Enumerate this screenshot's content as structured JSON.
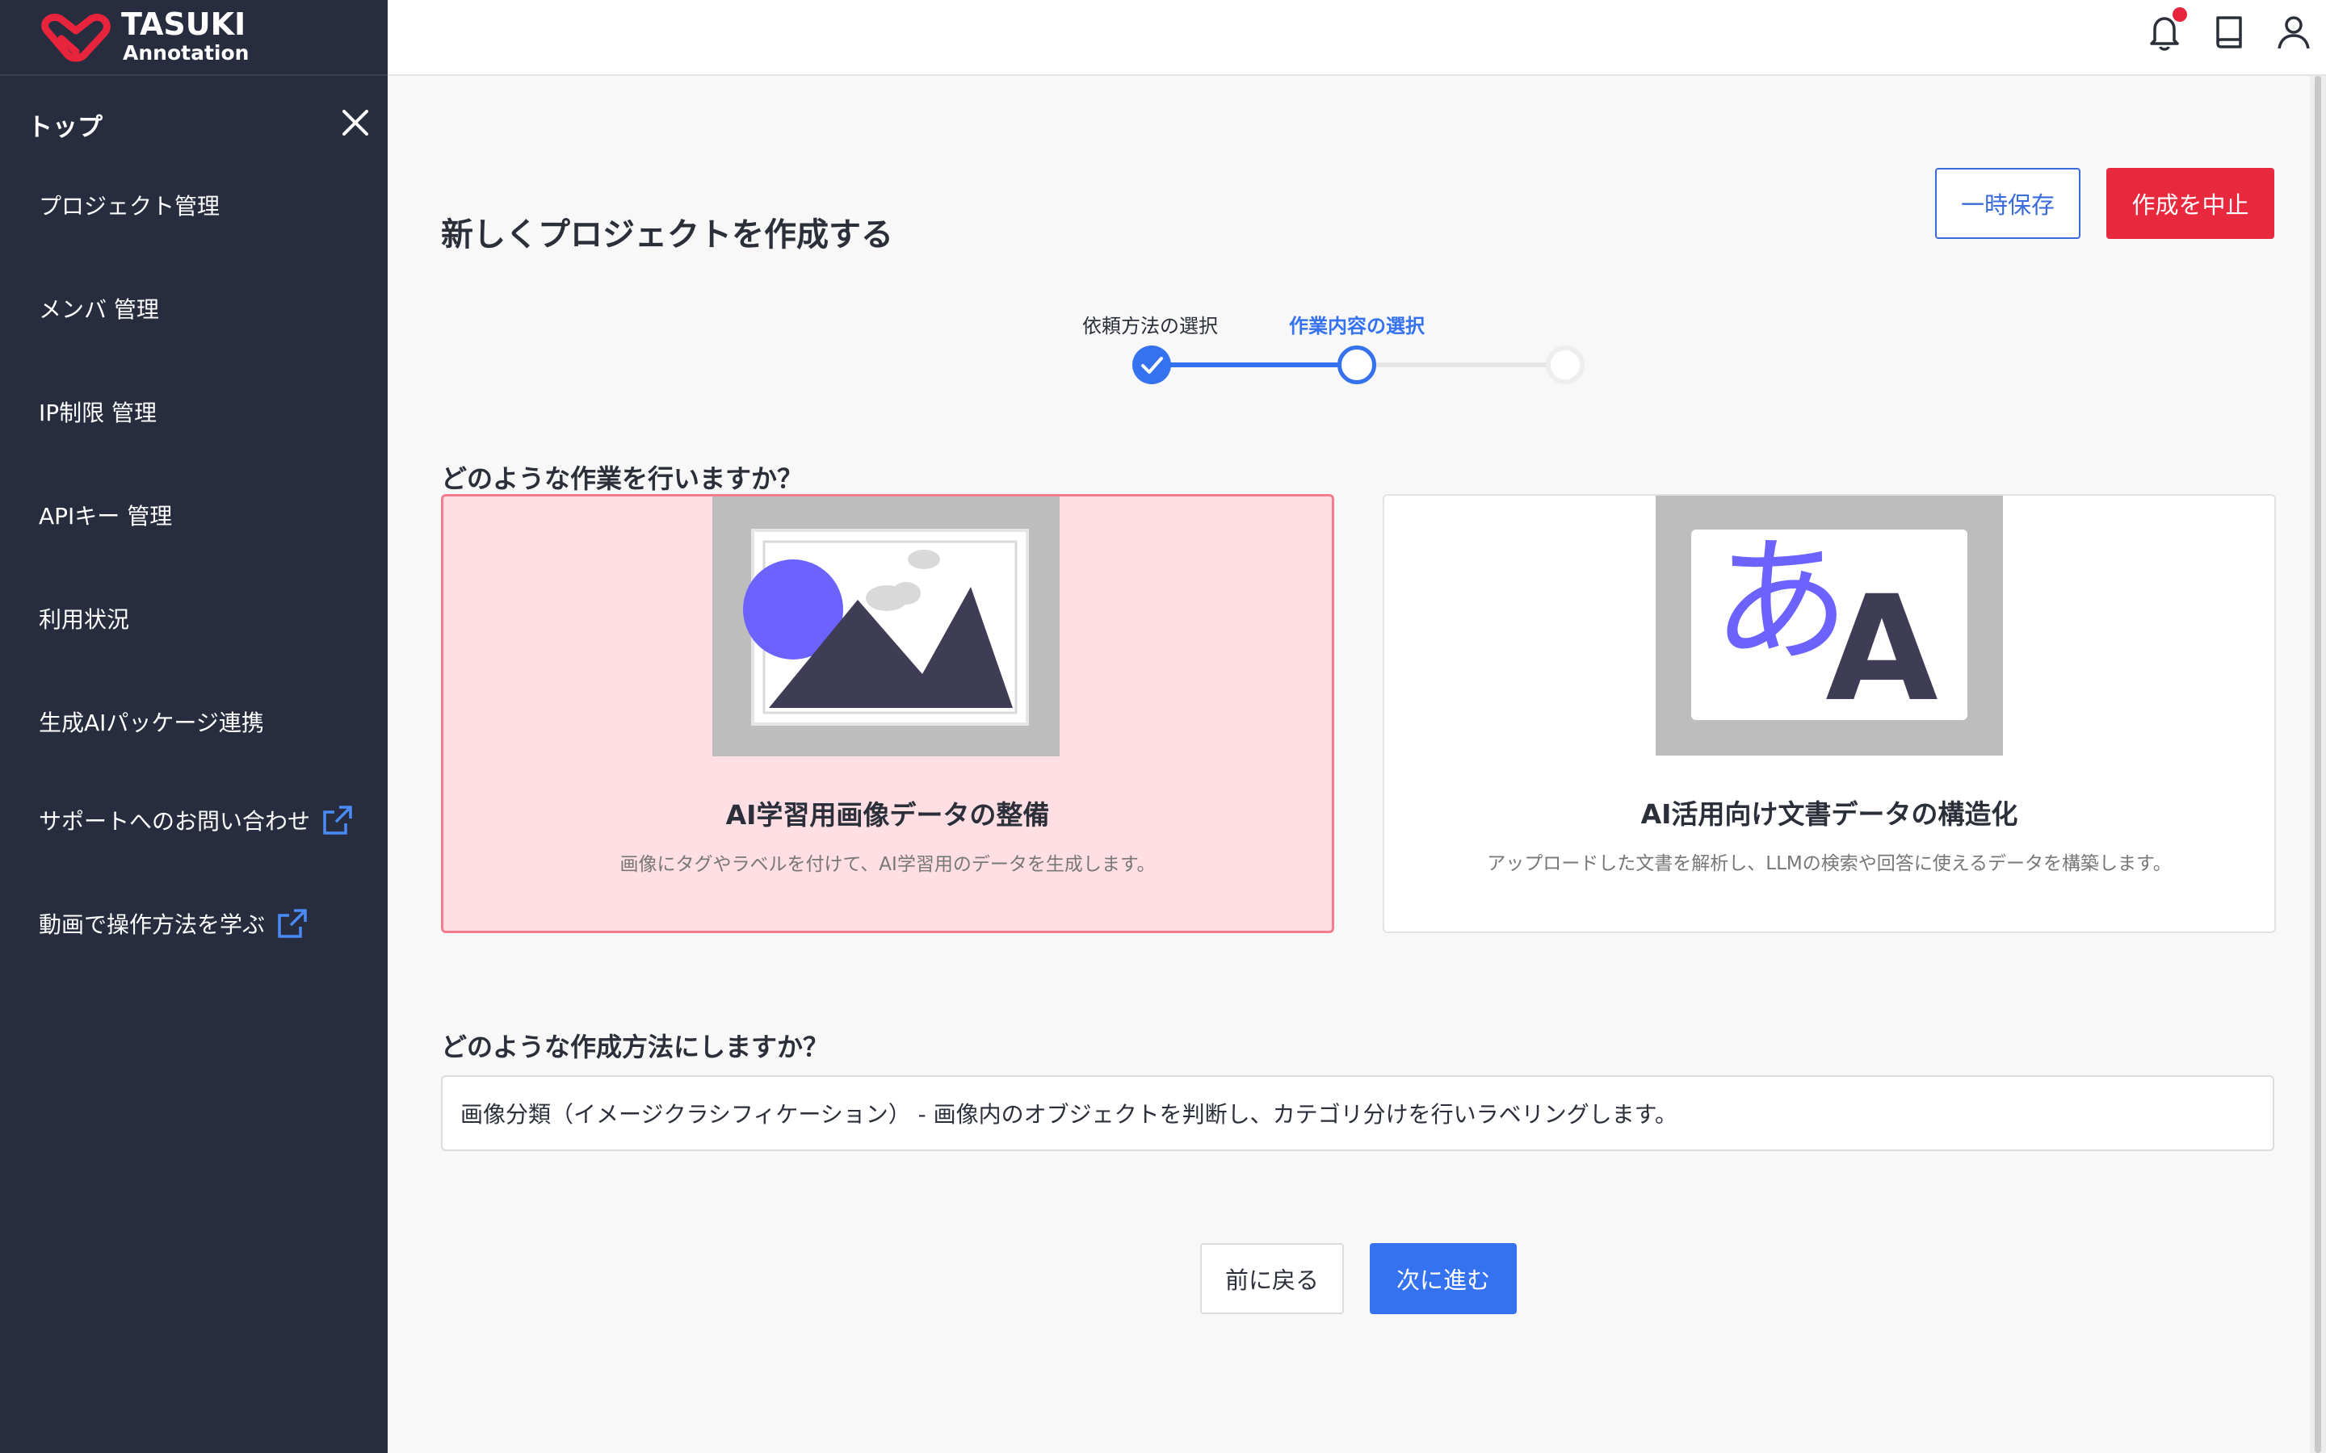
{
  "brand": {
    "name": "TASUKI",
    "sub": "Annotation",
    "accent": "#e8243c"
  },
  "sidebar": {
    "heading": "トップ",
    "items": [
      {
        "label": "プロジェクト管理",
        "external": false
      },
      {
        "label": "メンバ 管理",
        "external": false
      },
      {
        "label": "IP制限 管理",
        "external": false
      },
      {
        "label": "APIキー 管理",
        "external": false
      },
      {
        "label": "利用状況",
        "external": false
      },
      {
        "label": "生成AIパッケージ連携",
        "external": false
      },
      {
        "label": "サポートへのお問い合わせ",
        "external": true
      },
      {
        "label": "動画で操作方法を学ぶ",
        "external": true
      }
    ]
  },
  "topbar": {
    "icons": [
      "bell-icon",
      "book-icon",
      "user-icon"
    ],
    "has_notification": true
  },
  "page": {
    "title": "新しくプロジェクトを作成する",
    "temp_save": "一時保存",
    "cancel": "作成を中止"
  },
  "stepper": {
    "steps": [
      {
        "label": "依頼方法の選択",
        "state": "done"
      },
      {
        "label": "作業内容の選択",
        "state": "current"
      },
      {
        "label": "",
        "state": "pending"
      }
    ]
  },
  "work": {
    "question": "どのような作業を行いますか？",
    "cards": [
      {
        "title": "AI学習用画像データの整備",
        "desc": "画像にタグやラベルを付けて、AI学習用のデータを生成します。",
        "selected": true
      },
      {
        "title": "AI活用向け文書データの構造化",
        "desc": "アップロードした文書を解析し、LLMの検索や回答に使えるデータを構築します。",
        "selected": false,
        "glyph_a": "あ",
        "glyph_b": "A"
      }
    ]
  },
  "method": {
    "question": "どのような作成方法にしますか？",
    "value": "画像分類（イメージクラシフィケーション） - 画像内のオブジェクトを判断し、カテゴリ分けを行いラベリングします。"
  },
  "nav": {
    "back": "前に戻る",
    "next": "次に進む"
  },
  "colors": {
    "primary": "#3572ef",
    "danger": "#e8283c",
    "sidebar": "#272d3f",
    "selected_card": "#ffdfe3"
  }
}
